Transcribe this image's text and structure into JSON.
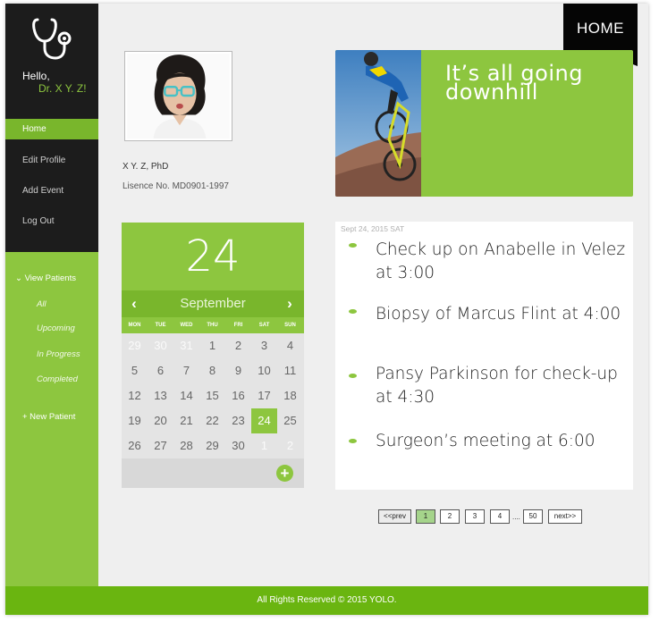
{
  "sidebar": {
    "greeting": "Hello,",
    "doctor": "Dr. X Y. Z!",
    "nav": [
      "Home",
      "Edit Profile",
      "Add Event",
      "Log Out"
    ],
    "patients_heading": "⌄ View Patients",
    "patients_filters": [
      "All",
      "Upcoming",
      "In Progress",
      "Completed"
    ],
    "new_patient": "+ New Patient"
  },
  "ribbon": {
    "label": "HOME"
  },
  "profile": {
    "name": "X Y. Z, PhD",
    "license": "Lisence No. MD0901-1997"
  },
  "banner": {
    "line1": "It’s all going",
    "line2": "downhill"
  },
  "calendar": {
    "day": "24",
    "month": "September",
    "prev": "‹",
    "next": "›",
    "weekdays": [
      "MON",
      "TUE",
      "WED",
      "THU",
      "FRI",
      "SAT",
      "SUN"
    ],
    "weeks": [
      [
        "29",
        "30",
        "31",
        "1",
        "2",
        "3",
        "4"
      ],
      [
        "5",
        "6",
        "7",
        "8",
        "9",
        "10",
        "11"
      ],
      [
        "12",
        "13",
        "14",
        "15",
        "16",
        "17",
        "18"
      ],
      [
        "19",
        "20",
        "21",
        "22",
        "23",
        "24",
        "25"
      ],
      [
        "26",
        "27",
        "28",
        "29",
        "30",
        "1",
        "2"
      ]
    ],
    "add": "+"
  },
  "events": {
    "date": "Sept 24, 2015 SAT",
    "items": [
      "Check up on Anabelle in Velez at 3:00",
      "Biopsy of Marcus Flint at 4:00",
      "Pansy Parkinson for check-up at 4:30",
      "Surgeon’s meeting at 6:00"
    ]
  },
  "pagination": {
    "prev": "<<prev",
    "pages": [
      "1",
      "2",
      "3",
      "4"
    ],
    "ellipsis": "....",
    "last": "50",
    "next": "next>>",
    "current": "1"
  },
  "footer": {
    "text": "All Rights Reserved © 2015 YOLO."
  },
  "colors": {
    "accent": "#8dc63f",
    "accent_dark": "#79b62c",
    "footer": "#6ab510",
    "sidebar_dark": "#1c1c1c"
  }
}
